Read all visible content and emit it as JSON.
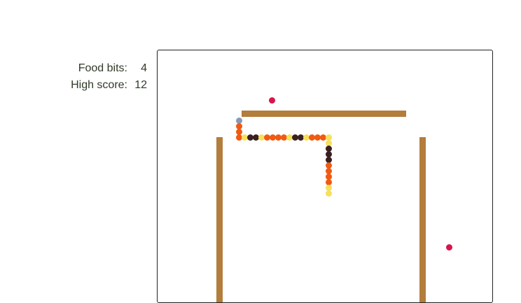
{
  "scoreboard": {
    "food_bits_label": "Food bits:",
    "food_bits_value": "4",
    "high_score_label": "High score:",
    "high_score_value": "12"
  },
  "colors": {
    "wall": "#b37d3c",
    "food": "#d8144a",
    "snake_head": "#8a97b5",
    "snake_orange": "#f05a12",
    "snake_dark": "#3a2020",
    "snake_yellow": "#f7e05a",
    "board_border": "#222222"
  },
  "snake": {
    "segment_colors": [
      "snake_head",
      "snake_orange",
      "snake_orange",
      "snake_orange",
      "snake_yellow",
      "snake_dark",
      "snake_dark",
      "snake_yellow",
      "snake_orange",
      "snake_orange",
      "snake_orange",
      "snake_orange",
      "snake_yellow",
      "snake_dark",
      "snake_dark",
      "snake_yellow",
      "snake_orange",
      "snake_orange",
      "snake_orange",
      "snake_yellow",
      "snake_yellow",
      "snake_dark",
      "snake_dark",
      "snake_dark",
      "snake_orange",
      "snake_orange",
      "snake_orange",
      "snake_orange",
      "snake_yellow",
      "snake_yellow"
    ]
  }
}
